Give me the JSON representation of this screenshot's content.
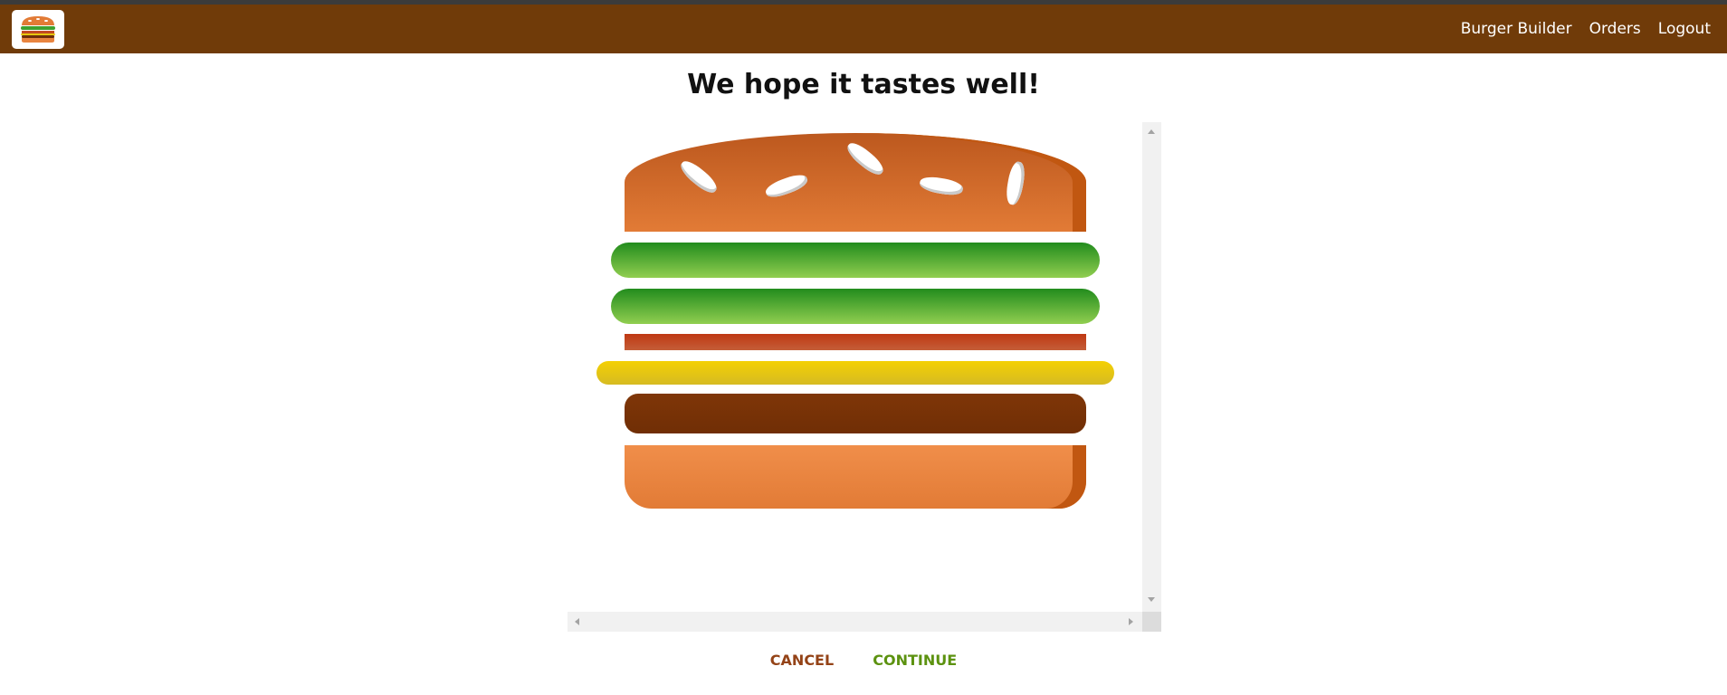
{
  "toolbar": {
    "logo_icon": "burger-logo-icon",
    "background_color": "#703b09",
    "nav": [
      {
        "label": "Burger Builder"
      },
      {
        "label": "Orders"
      },
      {
        "label": "Logout"
      }
    ]
  },
  "summary": {
    "title": "We hope it tastes well!"
  },
  "burger": {
    "ingredients": [
      "bread-top",
      "salad",
      "salad",
      "bacon",
      "cheese",
      "meat",
      "bread-bottom"
    ]
  },
  "actions": {
    "cancel_label": "CANCEL",
    "continue_label": "CONTINUE",
    "cancel_color": "#944317",
    "continue_color": "#5c9210"
  }
}
